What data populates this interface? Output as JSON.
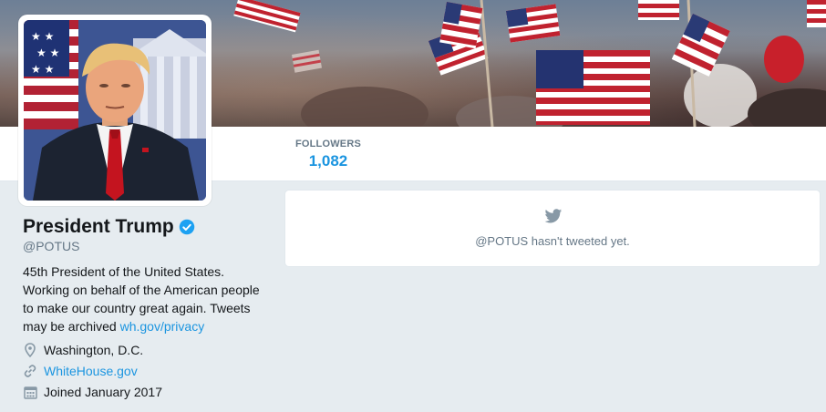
{
  "profile": {
    "name": "President Trump",
    "handle": "@POTUS",
    "bio_text": "45th President of the United States. Working on behalf of the American people to make our country great again. Tweets may be archived ",
    "bio_link": "wh.gov/privacy",
    "location": "Washington, D.C.",
    "website": "WhiteHouse.gov",
    "joined": "Joined January 2017"
  },
  "stats": {
    "followers_label": "FOLLOWERS",
    "followers_value": "1,082"
  },
  "timeline": {
    "empty_message": "@POTUS hasn't tweeted yet."
  },
  "colors": {
    "accent": "#1b95e0",
    "verified": "#1da1f2",
    "secondary_text": "#657786"
  }
}
